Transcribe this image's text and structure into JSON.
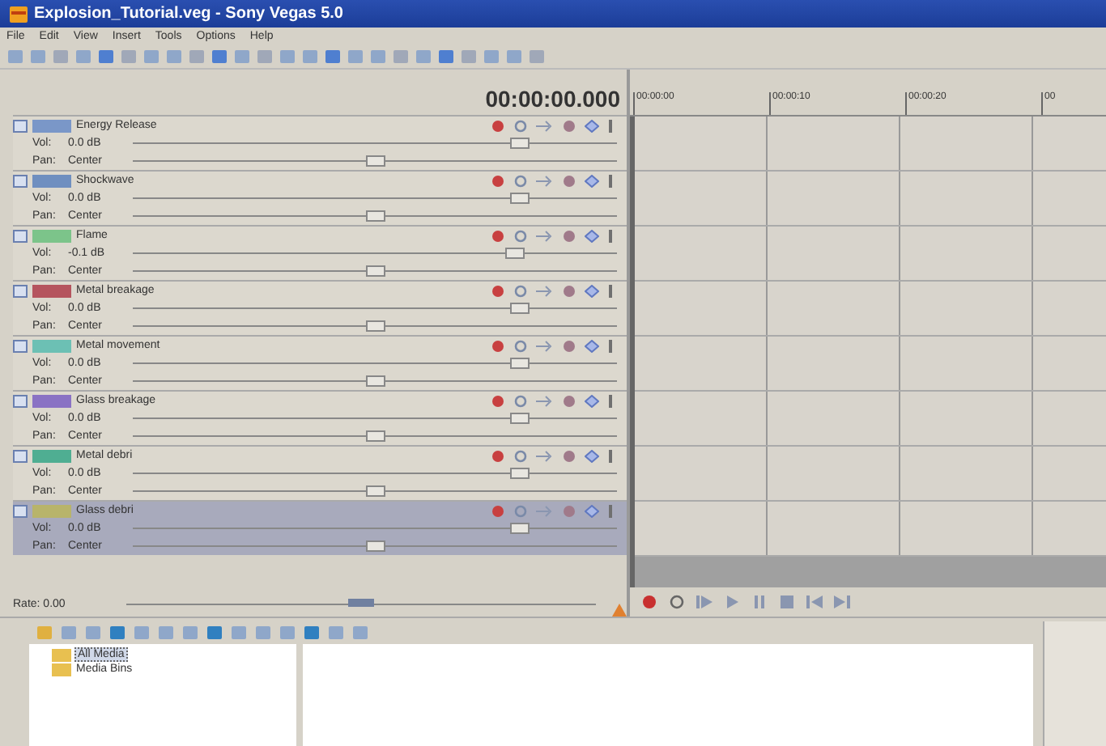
{
  "window": {
    "title": "Explosion_Tutorial.veg - Sony Vegas 5.0"
  },
  "menu": [
    "File",
    "Edit",
    "View",
    "Insert",
    "Tools",
    "Options",
    "Help"
  ],
  "timecode": "00:00:00.000",
  "tracks": [
    {
      "name": "Energy Release",
      "color": "#7a97c8",
      "volume": {
        "label": "Vol:",
        "value": "0.0 dB",
        "level": 0.8
      },
      "pan": {
        "label": "Pan:",
        "value": "Center",
        "level": 0.5
      },
      "selected": false
    },
    {
      "name": "Shockwave",
      "color": "#6f8fc0",
      "volume": {
        "label": "Vol:",
        "value": "0.0 dB",
        "level": 0.8
      },
      "pan": {
        "label": "Pan:",
        "value": "Center",
        "level": 0.5
      },
      "selected": false
    },
    {
      "name": "Flame",
      "color": "#7cc48a",
      "volume": {
        "label": "Vol:",
        "value": "-0.1 dB",
        "level": 0.79
      },
      "pan": {
        "label": "Pan:",
        "value": "Center",
        "level": 0.5
      },
      "selected": false
    },
    {
      "name": "Metal breakage",
      "color": "#b5545e",
      "volume": {
        "label": "Vol:",
        "value": "0.0 dB",
        "level": 0.8
      },
      "pan": {
        "label": "Pan:",
        "value": "Center",
        "level": 0.5
      },
      "selected": false
    },
    {
      "name": "Metal movement",
      "color": "#6cc0b4",
      "volume": {
        "label": "Vol:",
        "value": "0.0 dB",
        "level": 0.8
      },
      "pan": {
        "label": "Pan:",
        "value": "Center",
        "level": 0.5
      },
      "selected": false
    },
    {
      "name": "Glass breakage",
      "color": "#8a72c4",
      "volume": {
        "label": "Vol:",
        "value": "0.0 dB",
        "level": 0.8
      },
      "pan": {
        "label": "Pan:",
        "value": "Center",
        "level": 0.5
      },
      "selected": false
    },
    {
      "name": "Metal debri",
      "color": "#4fae92",
      "volume": {
        "label": "Vol:",
        "value": "0.0 dB",
        "level": 0.8
      },
      "pan": {
        "label": "Pan:",
        "value": "Center",
        "level": 0.5
      },
      "selected": false
    },
    {
      "name": "Glass debri",
      "color": "#b8b46a",
      "volume": {
        "label": "Vol:",
        "value": "0.0 dB",
        "level": 0.8
      },
      "pan": {
        "label": "Pan:",
        "value": "Center",
        "level": 0.5
      },
      "selected": true
    }
  ],
  "ruler": [
    "00:00:00",
    "00:00:10",
    "00:00:20",
    "00"
  ],
  "rate": {
    "label": "Rate: 0.00",
    "level": 0.5
  },
  "media_tree": [
    {
      "label": "All Media",
      "selected": true
    },
    {
      "label": "Media Bins",
      "selected": false
    }
  ]
}
